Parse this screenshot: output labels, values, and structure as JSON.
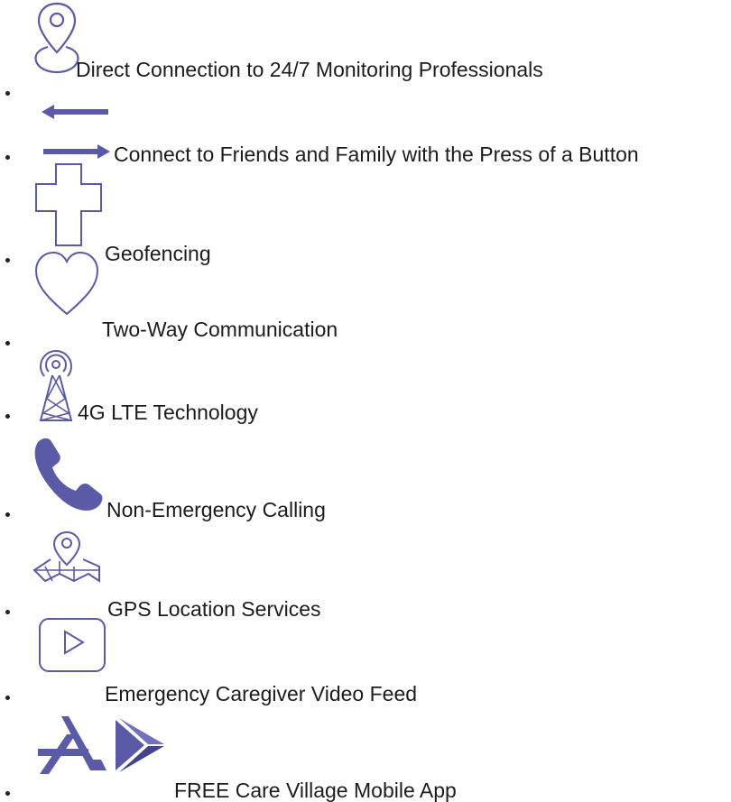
{
  "accent_color": "#5a5aa6",
  "features": [
    {
      "icon": "location-pin-icon",
      "label": "Direct Connection to 24/7 Monitoring Professionals"
    },
    {
      "icon": "two-way-arrows-icon",
      "label": "Connect to Friends and Family with the Press of a Button"
    },
    {
      "icon": "medical-cross-icon",
      "label": "Geofencing"
    },
    {
      "icon": "heart-icon",
      "label": "Two-Way Communication"
    },
    {
      "icon": "cell-tower-icon",
      "label": "4G LTE Technology"
    },
    {
      "icon": "phone-icon",
      "label": "Non-Emergency Calling"
    },
    {
      "icon": "map-pin-icon",
      "label": "GPS Location Services"
    },
    {
      "icon": "video-play-icon",
      "label": "Emergency Caregiver Video Feed"
    },
    {
      "icon": "app-store-icon",
      "label": "FREE Care Village Mobile App"
    }
  ]
}
